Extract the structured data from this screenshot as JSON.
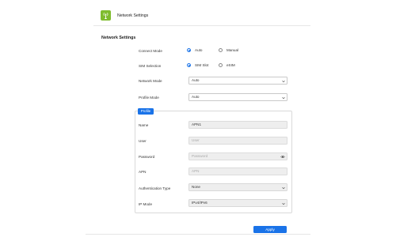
{
  "header": {
    "title": "Network Settings",
    "icon": "antenna-icon",
    "icon_color": "#7fbc2e"
  },
  "section": {
    "title": "Network Settings"
  },
  "connect_mode": {
    "label": "Connect Mode",
    "options": [
      "Auto",
      "Manual"
    ],
    "selected": "Auto"
  },
  "sim_selection": {
    "label": "SIM Selection",
    "options": [
      "SIM Slot",
      "eSIM"
    ],
    "selected": "SIM Slot"
  },
  "network_mode": {
    "label": "Network Mode",
    "value": "Auto"
  },
  "profile_mode": {
    "label": "Profile Mode",
    "value": "Auto"
  },
  "profile": {
    "tag": "Profile",
    "name": {
      "label": "Name",
      "value": "APN1"
    },
    "user": {
      "label": "User",
      "placeholder": "User"
    },
    "password": {
      "label": "Password",
      "placeholder": "Password"
    },
    "apn": {
      "label": "APN",
      "placeholder": "APN"
    },
    "auth_type": {
      "label": "Authentication Type",
      "value": "None"
    },
    "ip_mode": {
      "label": "IP Mode",
      "value": "IPv4/IPv6"
    }
  },
  "actions": {
    "apply_label": "Apply"
  },
  "colors": {
    "accent": "#1a73e8"
  }
}
